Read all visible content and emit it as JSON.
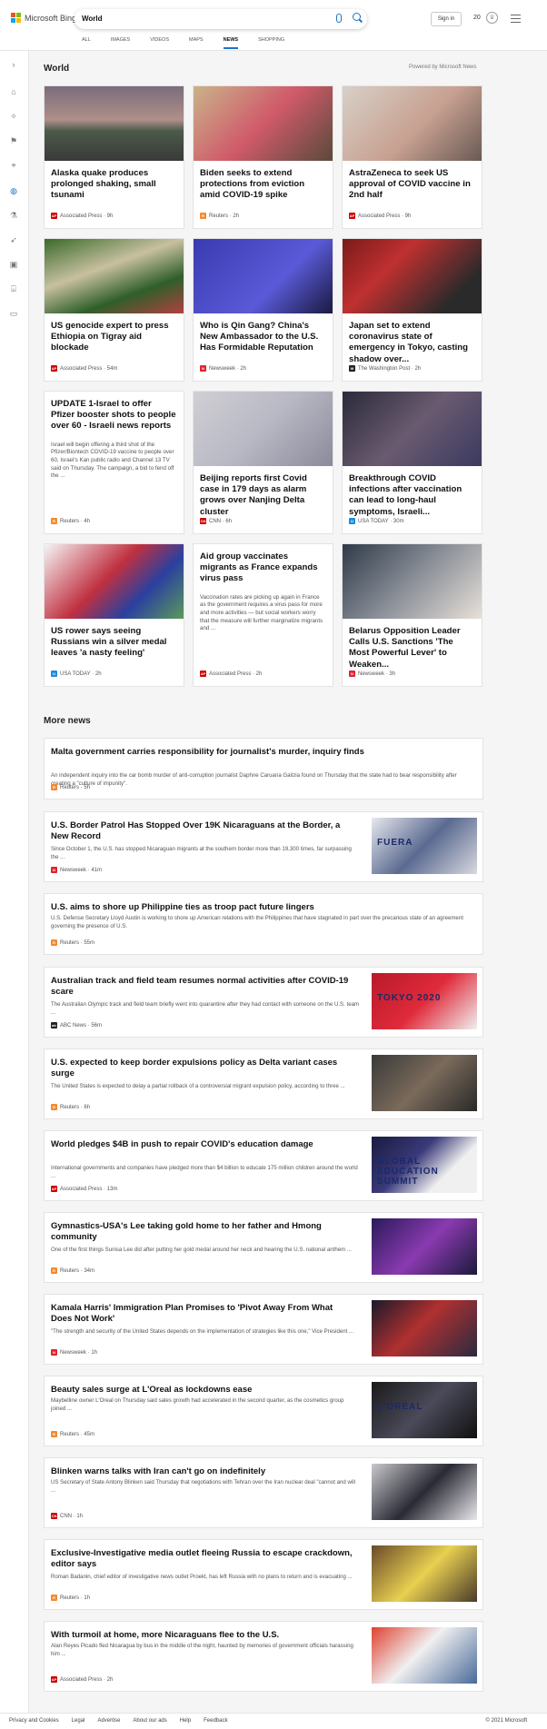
{
  "header": {
    "logo_text": "Microsoft Bing",
    "search_value": "World",
    "signin_label": "Sign in",
    "points": "20",
    "tabs": [
      "ALL",
      "IMAGES",
      "VIDEOS",
      "MAPS",
      "NEWS",
      "SHOPPING"
    ],
    "active_tab": "NEWS"
  },
  "main": {
    "section_title": "World",
    "powered_by": "Powered by Microsoft News",
    "more_title": "More news"
  },
  "cards": [
    {
      "title": "Alaska quake produces prolonged shaking, small tsunami",
      "source": "Associated Press · 9h",
      "logo": "AP",
      "logo_color": "#cc0000"
    },
    {
      "title": "Biden seeks to extend protections from eviction amid COVID-19 spike",
      "source": "Reuters · 2h",
      "logo": "R",
      "logo_color": "#f28a2e"
    },
    {
      "title": "AstraZeneca to seek US approval of COVID vaccine in 2nd half",
      "source": "Associated Press · 9h",
      "logo": "AP",
      "logo_color": "#cc0000"
    },
    {
      "title": "US genocide expert to press Ethiopia on Tigray aid blockade",
      "source": "Associated Press · 54m",
      "logo": "AP",
      "logo_color": "#cc0000"
    },
    {
      "title": "Who is Qin Gang? China's New Ambassador to the U.S. Has Formidable Reputation",
      "source": "Newsweek · 2h",
      "logo": "N",
      "logo_color": "#e0232e"
    },
    {
      "title": "Japan set to extend coronavirus state of emergency in Tokyo, casting shadow over...",
      "source": "The Washington Post · 2h",
      "logo": "W",
      "logo_color": "#222222"
    },
    {
      "title": "UPDATE 1-Israel to offer Pfizer booster shots to people over 60 - Israeli news reports",
      "summary": "Israel will begin offering a third shot of the Pfizer/Biontech COVID-19 vaccine to people over 60, Israel's Kan public radio and Channel 13 TV said on Thursday. The campaign, a bid to fend off the ...",
      "source": "Reuters · 4h",
      "logo": "R",
      "logo_color": "#f28a2e"
    },
    {
      "title": "Beijing reports first Covid case in 179 days as alarm grows over Nanjing Delta cluster",
      "source": "CNN · 6h",
      "logo": "CNN",
      "logo_color": "#cc0000"
    },
    {
      "title": "Breakthrough COVID infections after vaccination can lead to long-haul symptoms, Israeli...",
      "source": "USA TODAY · 30m",
      "logo": "U",
      "logo_color": "#1a8cdc"
    },
    {
      "title": "US rower says seeing Russians win a silver medal leaves 'a nasty feeling'",
      "source": "USA TODAY · 2h",
      "logo": "U",
      "logo_color": "#1a8cdc"
    },
    {
      "title": "Aid group vaccinates migrants as France expands virus pass",
      "summary": "Vaccination rates are picking up again in France as the government requires a virus pass for more and more activities — but social workers worry that the measure will further marginalize migrants and ...",
      "source": "Associated Press · 2h",
      "logo": "AP",
      "logo_color": "#cc0000"
    },
    {
      "title": "Belarus Opposition Leader Calls U.S. Sanctions 'The Most Powerful Lever' to Weaken...",
      "source": "Newsweek · 3h",
      "logo": "N",
      "logo_color": "#e0232e"
    }
  ],
  "more_news": [
    {
      "title": "Malta government carries responsibility for journalist's murder, inquiry finds",
      "summary": "An independent inquiry into the car bomb murder of anti-corruption journalist Daphne Caruana Galizia found on Thursday that the state had to bear responsibility after creating a \"culture of impunity\".",
      "source": "Reuters · 5h",
      "logo": "R",
      "logo_color": "#f28a2e"
    },
    {
      "title": "U.S. Border Patrol Has Stopped Over 19K Nicaraguans at the Border, a New Record",
      "summary": "Since October 1, the U.S. has stopped Nicaraguan migrants at the southern border more than 19,300 times, far surpassing the ...",
      "source": "Newsweek · 41m",
      "logo": "N",
      "logo_color": "#e0232e",
      "thumb_text": "FUERA"
    },
    {
      "title": "U.S. aims to shore up Philippine ties as troop pact future lingers",
      "summary": "U.S. Defense Secretary Lloyd Austin is working to shore up American relations with the Philippines that have stagnated in part over the precarious state of an agreement governing the presence of U.S.",
      "source": "Reuters · 55m",
      "logo": "R",
      "logo_color": "#f28a2e"
    },
    {
      "title": "Australian track and field team resumes normal activities after COVID-19 scare",
      "summary": "The Australian Olympic track and field team briefly went into quarantine after they had contact with someone on the U.S. team ...",
      "source": "ABC News · 56m",
      "logo": "abc",
      "logo_color": "#222222",
      "thumb_text": "TOKYO 2020"
    },
    {
      "title": "U.S. expected to keep border expulsions policy as Delta variant cases surge",
      "summary": "The United States is expected to delay a partial rollback of a controversial migrant expulsion policy, according to three ...",
      "source": "Reuters · 6h",
      "logo": "R",
      "logo_color": "#f28a2e"
    },
    {
      "title": "World pledges $4B in push to repair COVID's education damage",
      "summary": "International governments and companies have pledged more than $4 billion to educate 175 million children around the world ...",
      "source": "Associated Press · 13m",
      "logo": "AP",
      "logo_color": "#cc0000",
      "thumb_text": "GLOBAL EDUCATION SUMMIT"
    },
    {
      "title": "Gymnastics-USA's Lee taking gold home to her father and Hmong community",
      "summary": "One of the first things Sunisa Lee did after putting her gold medal around her neck and hearing the U.S. national anthem ...",
      "source": "Reuters · 34m",
      "logo": "R",
      "logo_color": "#f28a2e"
    },
    {
      "title": "Kamala Harris' Immigration Plan Promises to 'Pivot Away From What Does Not Work'",
      "summary": "\"The strength and security of the United States depends on the implementation of strategies like this one,\" Vice President ...",
      "source": "Newsweek · 1h",
      "logo": "N",
      "logo_color": "#e0232e"
    },
    {
      "title": "Beauty sales surge at L'Oreal as lockdowns ease",
      "summary": "Maybelline owner L'Oreal on Thursday said sales growth had accelerated in the second quarter, as the cosmetics group joined ...",
      "source": "Reuters · 45m",
      "logo": "R",
      "logo_color": "#f28a2e",
      "thumb_text": "L'ORÉAL"
    },
    {
      "title": "Blinken warns talks with Iran can't go on indefinitely",
      "summary": "US Secretary of State Antony Blinken said Thursday that negotiations with Tehran over the Iran nuclear deal \"cannot and will ...",
      "source": "CNN · 1h",
      "logo": "CNN",
      "logo_color": "#cc0000"
    },
    {
      "title": "Exclusive-Investigative media outlet fleeing Russia to escape crackdown, editor says",
      "summary": "Roman Badanin, chief editor of investigative news outlet Proekt, has left Russia with no plans to return and is evacuating ...",
      "source": "Reuters · 1h",
      "logo": "R",
      "logo_color": "#f28a2e"
    },
    {
      "title": "With turmoil at home, more Nicaraguans flee to the U.S.",
      "summary": "Alan Reyes Picado fled Nicaragua by bus in the middle of the night, haunted by memories of government officials harassing him ...",
      "source": "Associated Press · 2h",
      "logo": "AP",
      "logo_color": "#cc0000"
    }
  ],
  "footer": {
    "links": [
      "Privacy and Cookies",
      "Legal",
      "Advertise",
      "About our ads",
      "Help",
      "Feedback"
    ],
    "copyright": "© 2021 Microsoft"
  },
  "colors": {
    "accent": "#1a73c8"
  }
}
